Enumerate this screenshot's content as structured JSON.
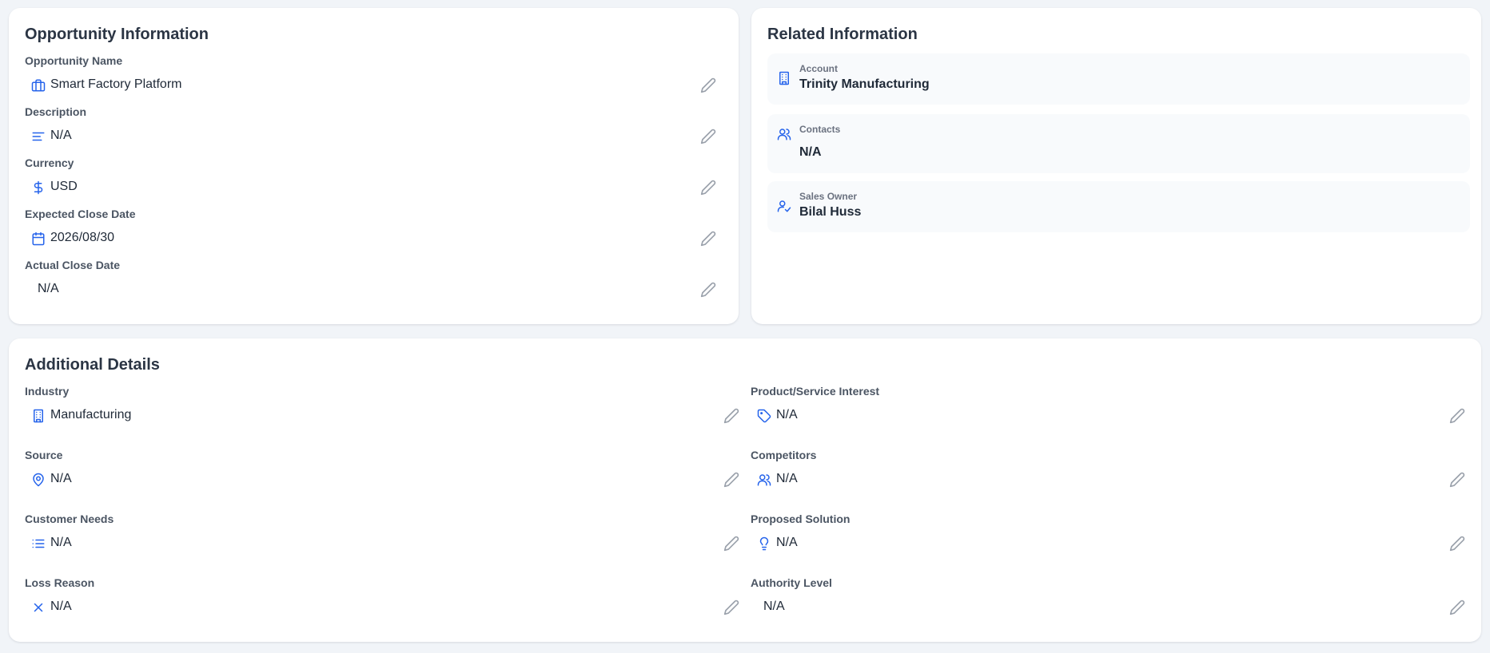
{
  "opportunity_info": {
    "title": "Opportunity Information",
    "fields": [
      {
        "label": "Opportunity Name",
        "value": "Smart Factory Platform",
        "icon": "briefcase-icon"
      },
      {
        "label": "Description",
        "value": "N/A",
        "icon": "align-left-icon"
      },
      {
        "label": "Currency",
        "value": "USD",
        "icon": "dollar-icon"
      },
      {
        "label": "Expected Close Date",
        "value": "2026/08/30",
        "icon": "calendar-icon"
      },
      {
        "label": "Actual Close Date",
        "value": "N/A",
        "icon": null
      }
    ]
  },
  "related_info": {
    "title": "Related Information",
    "items": [
      {
        "label": "Account",
        "value": "Trinity Manufacturing",
        "icon": "building-icon"
      },
      {
        "label": "Contacts",
        "value": "N/A",
        "icon": "users-icon"
      },
      {
        "label": "Sales Owner",
        "value": "Bilal Huss",
        "icon": "user-check-icon"
      }
    ]
  },
  "additional_details": {
    "title": "Additional Details",
    "left": [
      {
        "label": "Industry",
        "value": "Manufacturing",
        "icon": "building-icon"
      },
      {
        "label": "Source",
        "value": "N/A",
        "icon": "map-pin-icon"
      },
      {
        "label": "Customer Needs",
        "value": "N/A",
        "icon": "list-icon"
      },
      {
        "label": "Loss Reason",
        "value": "N/A",
        "icon": "x-icon"
      }
    ],
    "right": [
      {
        "label": "Product/Service Interest",
        "value": "N/A",
        "icon": "tag-icon"
      },
      {
        "label": "Competitors",
        "value": "N/A",
        "icon": "users-icon"
      },
      {
        "label": "Proposed Solution",
        "value": "N/A",
        "icon": "lightbulb-icon"
      },
      {
        "label": "Authority Level",
        "value": "N/A",
        "icon": null
      }
    ]
  },
  "colors": {
    "accent": "#2563eb",
    "background": "#f1f4f8",
    "card": "#ffffff",
    "edit_icon": "#9aa1ab"
  }
}
